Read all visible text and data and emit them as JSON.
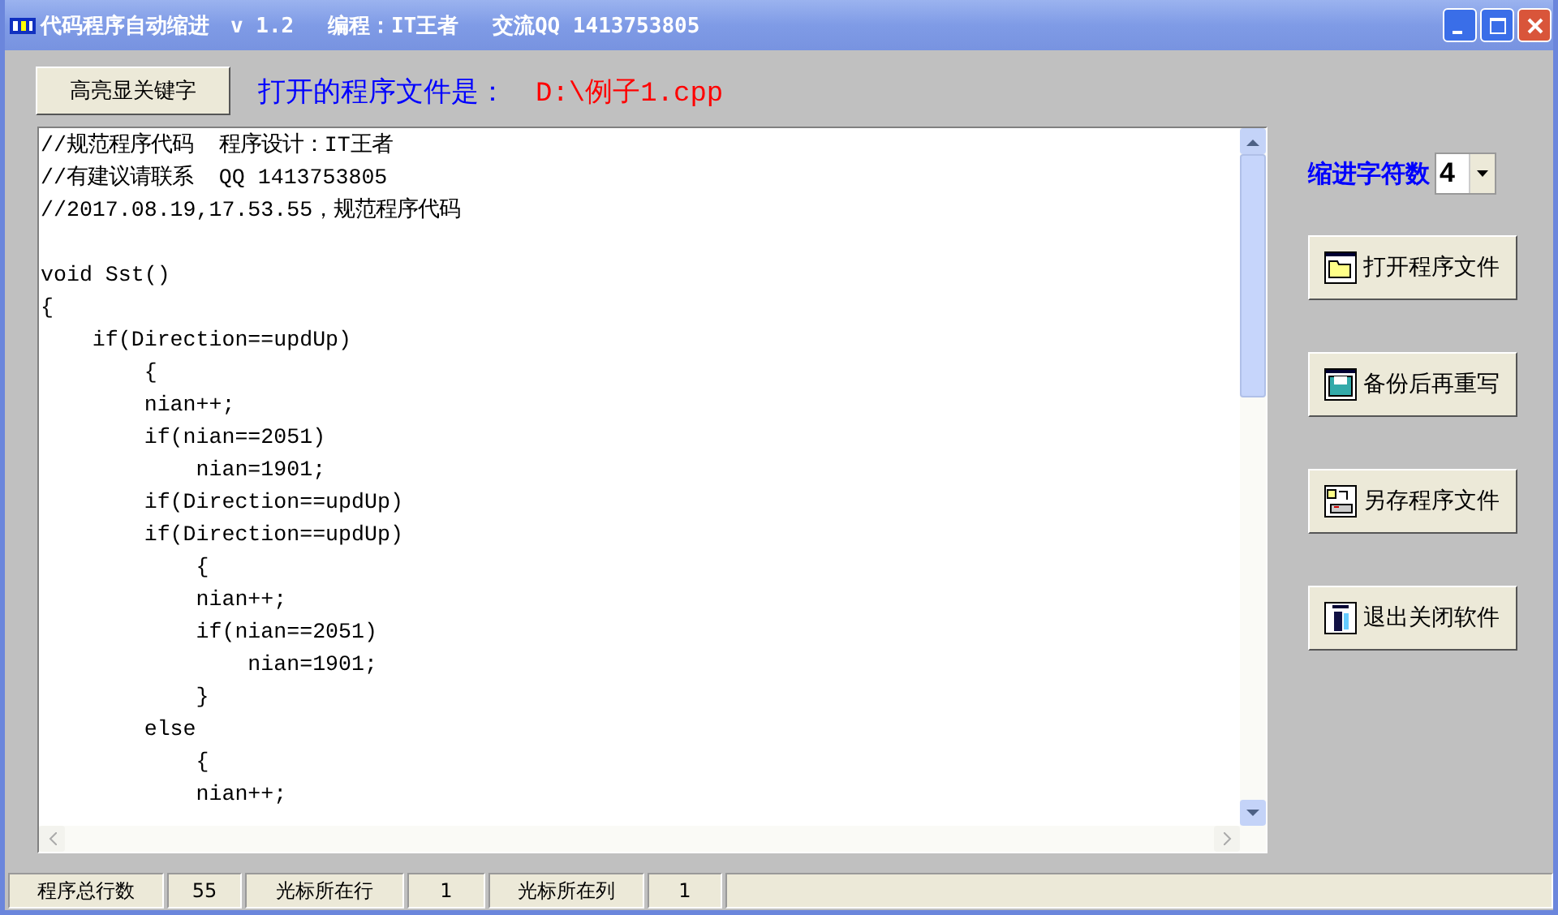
{
  "window": {
    "title": "代码程序自动缩进　v 1.2　 编程：IT王者　 交流QQ 1413753805"
  },
  "highlight_button": "高亮显关键字",
  "file_label": "打开的程序文件是：",
  "file_path": "D:\\例子1.cpp",
  "editor_header": [
    "//规范程序代码  程序设计：IT王者",
    "//有建议请联系  QQ 1413753805",
    "//2017.08.19,17.53.55，规范程序代码"
  ],
  "editor_lines": [
    "void Sst()",
    "{",
    "    if(Direction==updUp)",
    "        {",
    "        nian++;",
    "        if(nian==2051)",
    "            nian=1901;",
    "        if(Direction==updUp)",
    "        if(Direction==updUp)",
    "            {",
    "            nian++;",
    "            if(nian==2051)",
    "                nian=1901;",
    "            }",
    "        else",
    "            {",
    "            nian++;"
  ],
  "indent": {
    "label": "缩进字符数",
    "value": "4"
  },
  "actions": [
    {
      "label": "打开程序文件",
      "kind": "open"
    },
    {
      "label": "备份后再重写",
      "kind": "save"
    },
    {
      "label": "另存程序文件",
      "kind": "saveas"
    },
    {
      "label": "退出关闭软件",
      "kind": "exit"
    }
  ],
  "status_bar": [
    "程序总行数",
    "55",
    "光标所在行",
    "1",
    "光标所在列",
    "1"
  ]
}
